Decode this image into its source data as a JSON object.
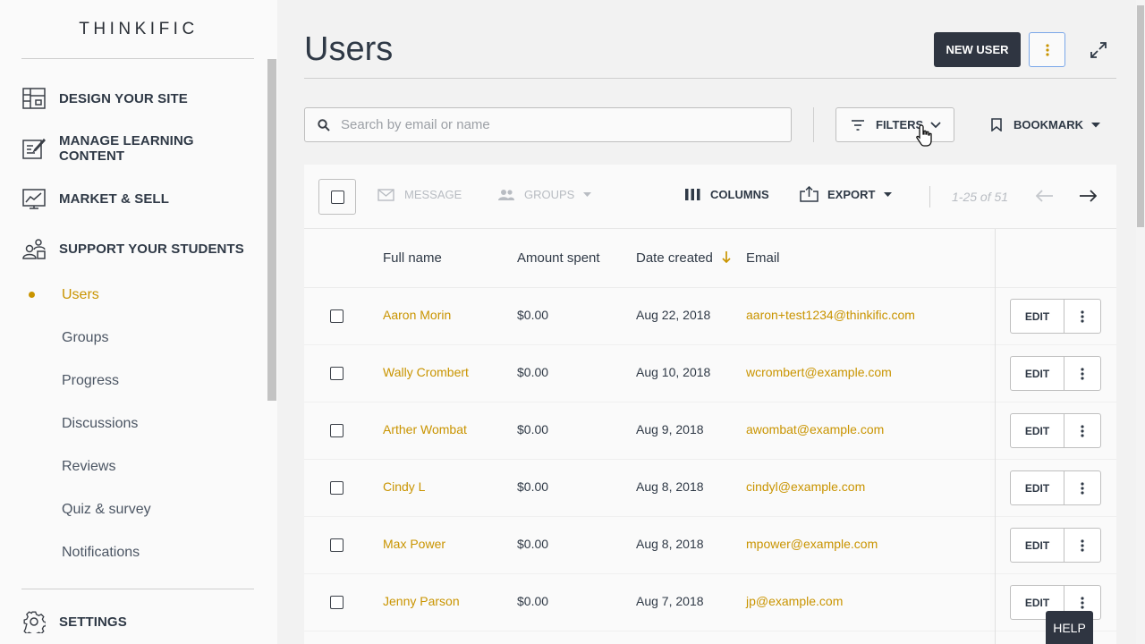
{
  "brand": {
    "logo": "THINKIFIC",
    "accent": "#c99400",
    "dark": "#2f3541"
  },
  "sidebar": {
    "main_items": [
      {
        "label": "DESIGN YOUR SITE",
        "icon": "layout-icon"
      },
      {
        "label": "MANAGE LEARNING CONTENT",
        "icon": "edit-document-icon"
      },
      {
        "label": "MARKET & SELL",
        "icon": "chart-icon"
      },
      {
        "label": "SUPPORT YOUR STUDENTS",
        "icon": "students-icon"
      }
    ],
    "sub_items": [
      "Users",
      "Groups",
      "Progress",
      "Discussions",
      "Reviews",
      "Quiz & survey",
      "Notifications"
    ],
    "active_sub": "Users",
    "settings": {
      "label": "SETTINGS",
      "icon": "gear-icon"
    }
  },
  "header": {
    "title": "Users",
    "new_user_label": "NEW USER"
  },
  "search": {
    "placeholder": "Search by email or name",
    "value": ""
  },
  "filters_label": "FILTERS",
  "bookmark_label": "BOOKMARK",
  "toolbar": {
    "message_label": "MESSAGE",
    "groups_label": "GROUPS",
    "columns_label": "COLUMNS",
    "export_label": "EXPORT",
    "pagination": "1-25 of 51"
  },
  "table": {
    "columns": [
      "Full name",
      "Amount spent",
      "Date created",
      "Email"
    ],
    "sort_column": "Date created",
    "sort_direction": "descending",
    "edit_label": "EDIT",
    "rows": [
      {
        "name": "Aaron Morin",
        "amount": "$0.00",
        "date": "Aug 22, 2018",
        "email": "aaron+test1234@thinkific.com"
      },
      {
        "name": "Wally Crombert",
        "amount": "$0.00",
        "date": "Aug 10, 2018",
        "email": "wcrombert@example.com"
      },
      {
        "name": "Arther Wombat",
        "amount": "$0.00",
        "date": "Aug 9, 2018",
        "email": "awombat@example.com"
      },
      {
        "name": "Cindy L",
        "amount": "$0.00",
        "date": "Aug 8, 2018",
        "email": "cindyl@example.com"
      },
      {
        "name": "Max Power",
        "amount": "$0.00",
        "date": "Aug 8, 2018",
        "email": "mpower@example.com"
      },
      {
        "name": "Jenny Parson",
        "amount": "$0.00",
        "date": "Aug 7, 2018",
        "email": "jp@example.com"
      }
    ]
  },
  "help_label": "HELP"
}
